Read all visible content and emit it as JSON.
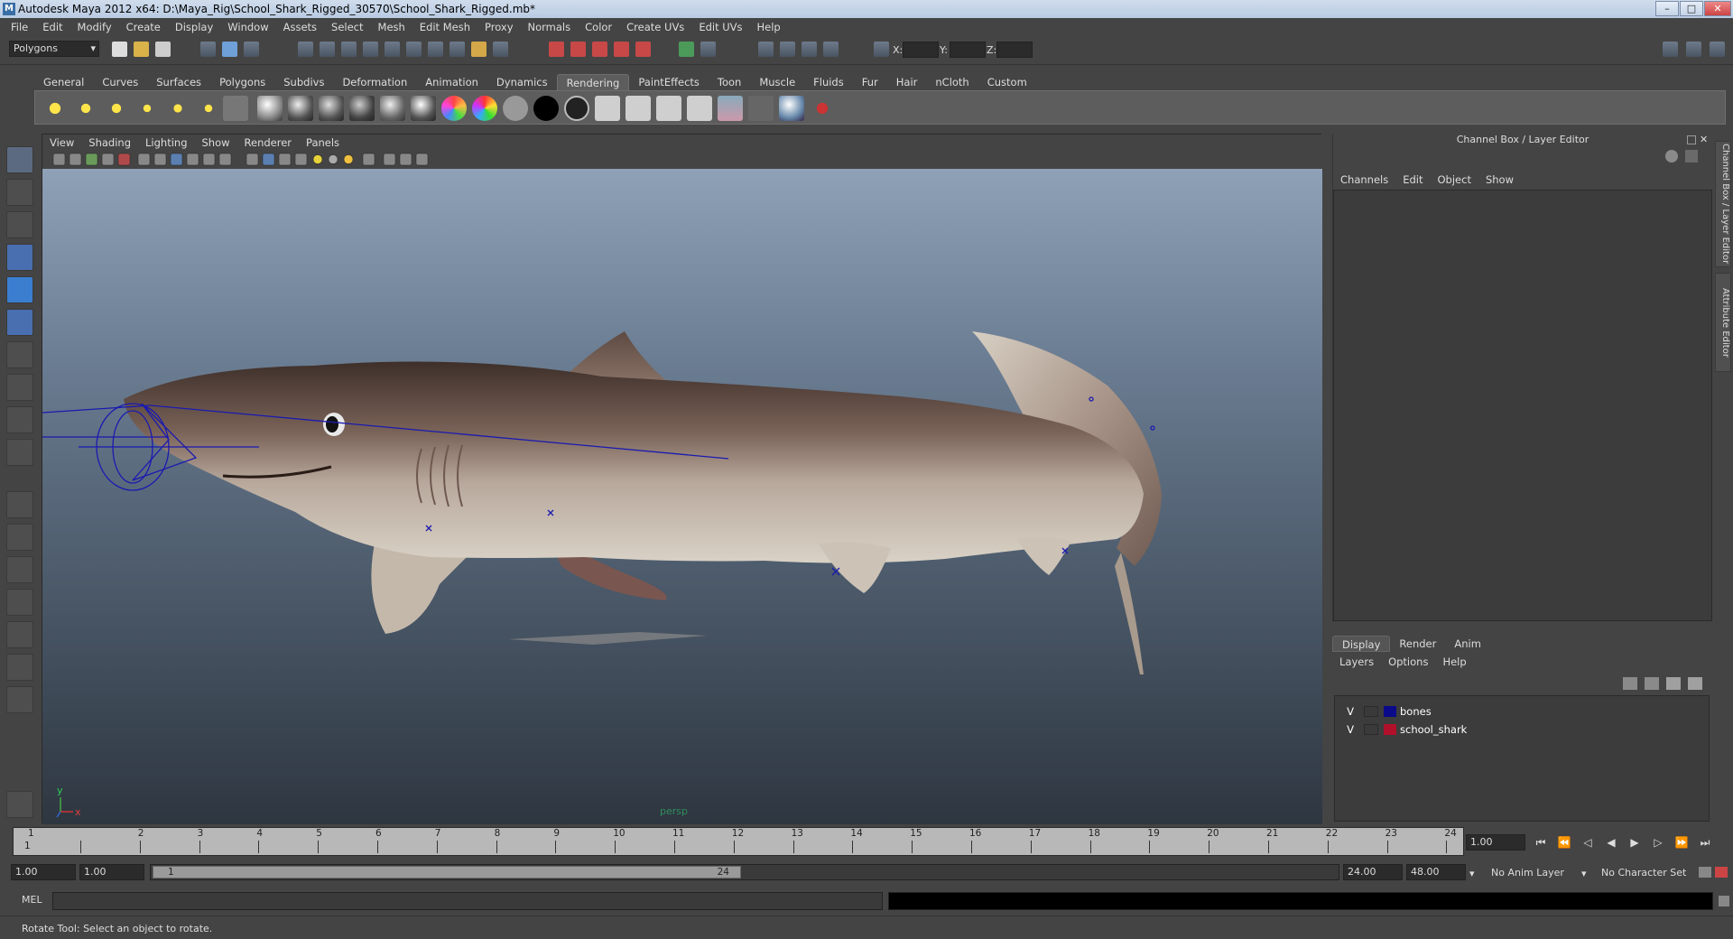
{
  "window": {
    "title": "Autodesk Maya 2012 x64: D:\\Maya_Rig\\School_Shark_Rigged_30570\\School_Shark_Rigged.mb*"
  },
  "menus": [
    "File",
    "Edit",
    "Modify",
    "Create",
    "Display",
    "Window",
    "Assets",
    "Select",
    "Mesh",
    "Edit Mesh",
    "Proxy",
    "Normals",
    "Color",
    "Create UVs",
    "Edit UVs",
    "Help"
  ],
  "status_line": {
    "mode": "Polygons",
    "x_label": "X:",
    "y_label": "Y:",
    "z_label": "Z:"
  },
  "shelf_tabs": [
    "General",
    "Curves",
    "Surfaces",
    "Polygons",
    "Subdivs",
    "Deformation",
    "Animation",
    "Dynamics",
    "Rendering",
    "PaintEffects",
    "Toon",
    "Muscle",
    "Fluids",
    "Fur",
    "Hair",
    "nCloth",
    "Custom"
  ],
  "active_shelf_tab": "Rendering",
  "viewport": {
    "menus": [
      "View",
      "Shading",
      "Lighting",
      "Show",
      "Renderer",
      "Panels"
    ],
    "camera_label": "persp",
    "axis_y": "y",
    "axis_x": "x"
  },
  "channel_box": {
    "title": "Channel Box / Layer Editor",
    "menus": [
      "Channels",
      "Edit",
      "Object",
      "Show"
    ]
  },
  "side_tabs": [
    "Channel Box / Layer Editor",
    "Attribute Editor"
  ],
  "layer_editor": {
    "tabs": [
      "Display",
      "Render",
      "Anim"
    ],
    "active_tab": "Display",
    "menus": [
      "Layers",
      "Options",
      "Help"
    ],
    "layers": [
      {
        "visible": "V",
        "name": "bones",
        "color": "#0a0a8a"
      },
      {
        "visible": "V",
        "name": "school_shark",
        "color": "#b0102a"
      }
    ]
  },
  "timeline": {
    "start_label": "1",
    "ticks": [
      "1",
      "2",
      "3",
      "4",
      "5",
      "6",
      "7",
      "8",
      "9",
      "10",
      "11",
      "12",
      "13",
      "14",
      "15",
      "16",
      "17",
      "18",
      "19",
      "20",
      "21",
      "22",
      "23",
      "24"
    ],
    "current_frame": "1.00"
  },
  "range": {
    "start_time": "1.00",
    "playback_start": "1.00",
    "range_start_label": "1",
    "range_end_label": "24",
    "playback_end": "24.00",
    "end_time": "48.00",
    "anim_layer": "No Anim Layer",
    "character_set": "No Character Set"
  },
  "command_line": {
    "label": "MEL"
  },
  "help_line": {
    "text": "Rotate Tool: Select an object to rotate."
  },
  "colors": {
    "shark_body": "#7a6358",
    "shark_belly": "#d8d2c6",
    "bones": "#1a1ab0",
    "accent_tab": "#5d5d5d"
  }
}
